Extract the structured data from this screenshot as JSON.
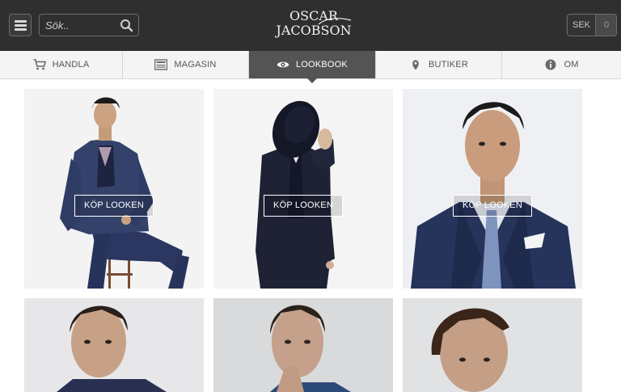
{
  "header": {
    "search_placeholder": "Sök..",
    "logo_line1": "OSCAR",
    "logo_line2": "JACOBSON",
    "currency": "SEK",
    "cart_count": "0"
  },
  "nav": {
    "items": [
      {
        "label": "HANDLA",
        "icon": "cart-icon"
      },
      {
        "label": "MAGASIN",
        "icon": "magazine-icon"
      },
      {
        "label": "LOOKBOOK",
        "icon": "eye-icon",
        "active": true
      },
      {
        "label": "BUTIKER",
        "icon": "location-pin-icon"
      },
      {
        "label": "OM",
        "icon": "info-icon"
      }
    ]
  },
  "lookbook": {
    "buy_label": "KÖP LOOKEN",
    "tiles": [
      {
        "id": 1,
        "has_button": true
      },
      {
        "id": 2,
        "has_button": true
      },
      {
        "id": 3,
        "has_button": true
      },
      {
        "id": 4,
        "has_button": false
      },
      {
        "id": 5,
        "has_button": false
      },
      {
        "id": 6,
        "has_button": false
      }
    ]
  },
  "colors": {
    "header_bg": "#2f2f2f",
    "nav_bg": "#f4f4f4",
    "nav_active": "#545454",
    "suit_navy": "#26335a"
  }
}
